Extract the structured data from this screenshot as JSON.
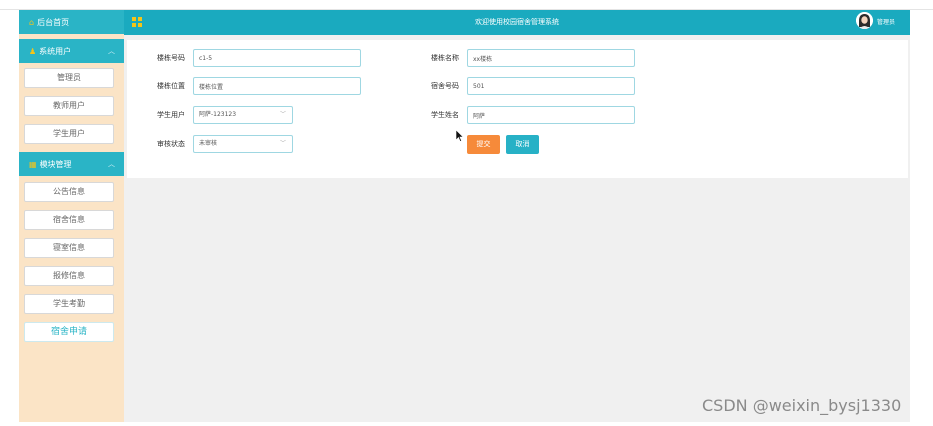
{
  "sidebar": {
    "home": {
      "label": "后台首页"
    },
    "sections": [
      {
        "title": "系统用户",
        "items": [
          "管理员",
          "教师用户",
          "学生用户"
        ]
      },
      {
        "title": "模块管理",
        "items": [
          "公告信息",
          "宿舍信息",
          "寝室信息",
          "报修信息",
          "学生考勤",
          "宿舍申请"
        ]
      }
    ]
  },
  "header": {
    "title": "欢迎使用校园宿舍管理系统",
    "user": "管理员"
  },
  "form": {
    "building_no": {
      "label": "楼栋号码",
      "value": "c1-5"
    },
    "building_name": {
      "label": "楼栋名称",
      "value": "xx楼栋"
    },
    "building_loc": {
      "label": "楼栋位置",
      "value": "楼栋位置"
    },
    "room_no": {
      "label": "宿舍号码",
      "value": "501"
    },
    "student_user": {
      "label": "学生用户",
      "value": "阿萨-123123"
    },
    "student_name": {
      "label": "学生姓名",
      "value": "阿萨"
    },
    "audit_status": {
      "label": "审核状态",
      "value": "未审核"
    },
    "submit": "提交",
    "cancel": "取消"
  },
  "watermark": "CSDN @weixin_bysj1330",
  "colors": {
    "accent": "#1aaabf",
    "sidebar_bg": "#fbe4c6",
    "submit": "#f68a3a",
    "cancel": "#27b1c6"
  }
}
